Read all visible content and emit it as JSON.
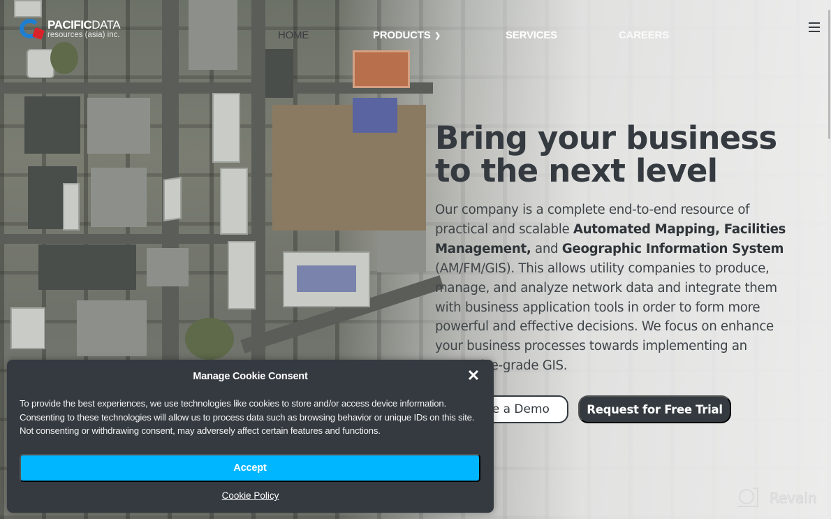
{
  "brand": {
    "name_bold": "PACIFIC",
    "name_light": "DATA",
    "tagline": "resources (asia) inc.",
    "colors": {
      "logo_blue": "#1e7fd2",
      "logo_red": "#d8232a"
    }
  },
  "nav": {
    "items": [
      {
        "label": "HOME"
      },
      {
        "label": "PRODUCTS",
        "has_dropdown": true,
        "dropdown_icon": "chevron-down-icon"
      },
      {
        "label": "SERVICES"
      },
      {
        "label": "CAREERS"
      }
    ],
    "menu_icon": "hamburger-menu-icon"
  },
  "hero": {
    "title_line1": "Bring your business",
    "title_line2": "to the next level",
    "description": [
      {
        "text": "Our company is a complete end-to-end resource of practical and scalable ",
        "bold": false
      },
      {
        "text": "Automated Mapping, Facilities Management,",
        "bold": true
      },
      {
        "text": " and ",
        "bold": false
      },
      {
        "text": "Geographic Information System",
        "bold": true
      },
      {
        "text": " (AM/FM/GIS). This allows utility companies to produce, manage, and analyze network data and integrate them with business application tools in order to form more powerful and effective decisions. We focus on enhance your business processes towards implementing an Enterprise-grade GIS.",
        "bold": false
      }
    ],
    "buttons": {
      "demo_label": "Schedule a Demo",
      "trial_label": "Request for Free Trial"
    },
    "colors": {
      "heading": "#343a40",
      "button_dark": "#343a40"
    }
  },
  "cookie_consent": {
    "title": "Manage Cookie Consent",
    "close_icon": "close-icon",
    "message": "To provide the best experiences, we use technologies like cookies to store and/or access device information. Consenting to these technologies will allow us to process data such as browsing behavior or unique IDs on this site. Not consenting or withdrawing consent, may adversely affect certain features and functions.",
    "accept_label": "Accept",
    "policy_link": "Cookie Policy",
    "colors": {
      "background": "#343a40",
      "accept": "#00b6ff"
    }
  },
  "watermark": {
    "text": "Revain",
    "icon": "revain-logo-icon"
  }
}
